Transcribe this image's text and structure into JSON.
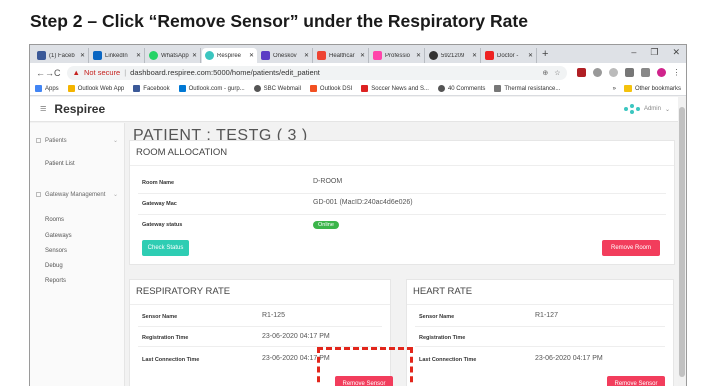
{
  "slide": {
    "heading": "Step 2 – Click “Remove Sensor” under the Respiratory Rate"
  },
  "browser": {
    "tabs": [
      {
        "label": "(1) Faceb",
        "color": "#3b5998"
      },
      {
        "label": "LinkedIn",
        "color": "#0a66c2"
      },
      {
        "label": "WhatsApp",
        "color": "#25d366"
      },
      {
        "label": "Respiree",
        "color": "#3cc6c0",
        "active": true
      },
      {
        "label": "Oneskov",
        "color": "#5b3cc4"
      },
      {
        "label": "Healthcar",
        "color": "#e43"
      },
      {
        "label": "Professio",
        "color": "#f4a"
      },
      {
        "label": "5921209",
        "color": "#333"
      },
      {
        "label": "Doctor -",
        "color": "#e22"
      }
    ],
    "new_tab": "+",
    "window_controls": [
      "–",
      "❐",
      "✕"
    ],
    "nav": {
      "back": "←",
      "forward": "→",
      "reload": "C"
    },
    "url": {
      "warning": "▲",
      "not_secure": "Not secure",
      "separator": "|",
      "text": "dashboard.respiree.com:5000/home/patients/edit_patient"
    },
    "bookmarks": [
      {
        "label": "Apps",
        "color": "#4285f4"
      },
      {
        "label": "Outlook Web App",
        "color": "#f4b400"
      },
      {
        "label": "Facebook",
        "color": "#3b5998"
      },
      {
        "label": "Outlook.com - gurp...",
        "color": "#0078d4"
      },
      {
        "label": "SBC Webmail",
        "color": "#555"
      },
      {
        "label": "Outlook DSI",
        "color": "#f25022"
      },
      {
        "label": "Soccer News and S...",
        "color": "#d22"
      },
      {
        "label": "40 Comments",
        "color": "#555"
      },
      {
        "label": "Thermal resistance...",
        "color": "#777"
      }
    ],
    "bookmarks_overflow": "»",
    "other_bookmarks": "Other bookmarks"
  },
  "app": {
    "menu_icon": "≡",
    "brand": "Respiree",
    "user": "Admin",
    "user_chevron": "⌄"
  },
  "sidebar": {
    "group1": {
      "label": "Patients",
      "chevron": "⌄"
    },
    "patient_list": "Patient List",
    "group2": {
      "label": "Gateway Management",
      "chevron": "⌄"
    },
    "items": [
      "Rooms",
      "Gateways",
      "Sensors",
      "Debug",
      "Reports"
    ]
  },
  "main": {
    "page_title": "PATIENT : TESTG ( 3 )",
    "room": {
      "title": "ROOM ALLOCATION",
      "room_name_label": "Room Name",
      "room_name": "D-ROOM",
      "gateway_mac_label": "Gateway Mac",
      "gateway_mac": "GD-001 (MacID:240ac4d6e026)",
      "gateway_status_label": "Gateway status",
      "gateway_status": "Online",
      "check_status": "Check Status",
      "remove_room": "Remove Room"
    },
    "resp": {
      "title": "RESPIRATORY RATE",
      "sensor_name_label": "Sensor Name",
      "sensor_name": "R1-125",
      "reg_time_label": "Registration Time",
      "reg_time": "23-06-2020 04:17 PM",
      "last_conn_label": "Last Connection Time",
      "last_conn": "23-06-2020 04:17 PM",
      "remove_sensor": "Remove Sensor"
    },
    "heart": {
      "title": "HEART RATE",
      "sensor_name_label": "Sensor Name",
      "sensor_name": "R1-127",
      "reg_time_label": "Registration Time",
      "reg_time": "",
      "last_conn_label": "Last Connection Time",
      "last_conn": "23-06-2020 04:17 PM",
      "remove_sensor": "Remove Sensor"
    }
  },
  "colors": {
    "teal": "#2ecdb3",
    "red": "#f23d5c",
    "online": "#3bb54a",
    "callout": "#e2261b"
  }
}
